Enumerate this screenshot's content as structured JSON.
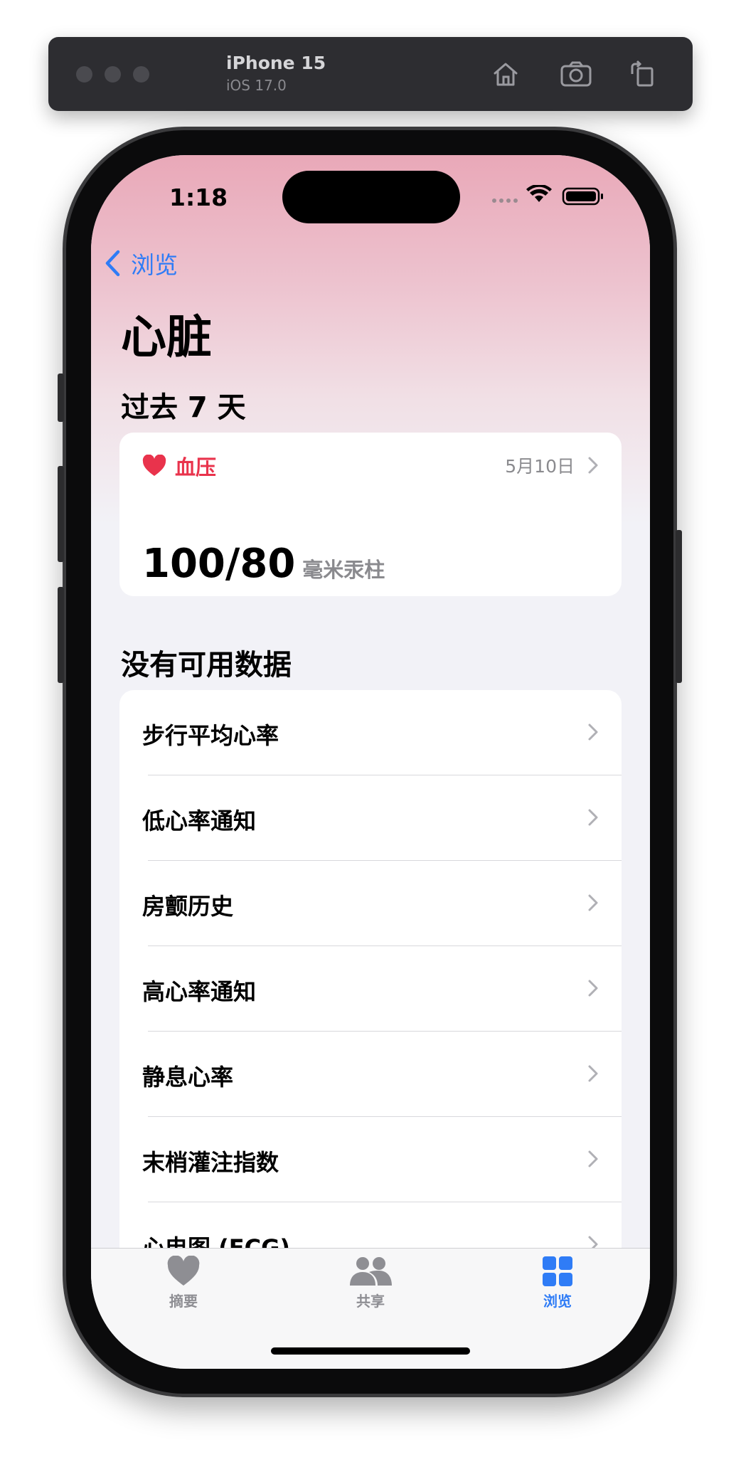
{
  "simulator": {
    "device_name": "iPhone 15",
    "os_version": "iOS 17.0",
    "buttons": [
      "home-icon",
      "screenshot-icon",
      "rotate-icon"
    ]
  },
  "status_bar": {
    "time": "1:18"
  },
  "nav": {
    "back_label": "浏览",
    "title": "心脏"
  },
  "past_7_days": {
    "header": "过去 7 天",
    "card": {
      "icon": "heart-icon",
      "name": "血压",
      "date": "5月10日",
      "value": "100/80",
      "unit": "毫米汞柱"
    }
  },
  "no_data": {
    "header": "没有可用数据",
    "items": [
      {
        "label": "步行平均心率"
      },
      {
        "label": "低心率通知"
      },
      {
        "label": "房颤历史"
      },
      {
        "label": "高心率通知"
      },
      {
        "label": "静息心率"
      },
      {
        "label": "末梢灌注指数"
      },
      {
        "label": "心电图 (ECG)"
      }
    ]
  },
  "tab_bar": {
    "tabs": [
      {
        "label": "摘要",
        "icon": "heart-icon",
        "active": false
      },
      {
        "label": "共享",
        "icon": "people-icon",
        "active": false
      },
      {
        "label": "浏览",
        "icon": "grid-icon",
        "active": true
      }
    ]
  },
  "colors": {
    "accent": "#2f7cf6",
    "heart_red": "#e9334c",
    "secondary_text": "#8a8a8e",
    "header_gradient_top": "#e9a8b8"
  }
}
